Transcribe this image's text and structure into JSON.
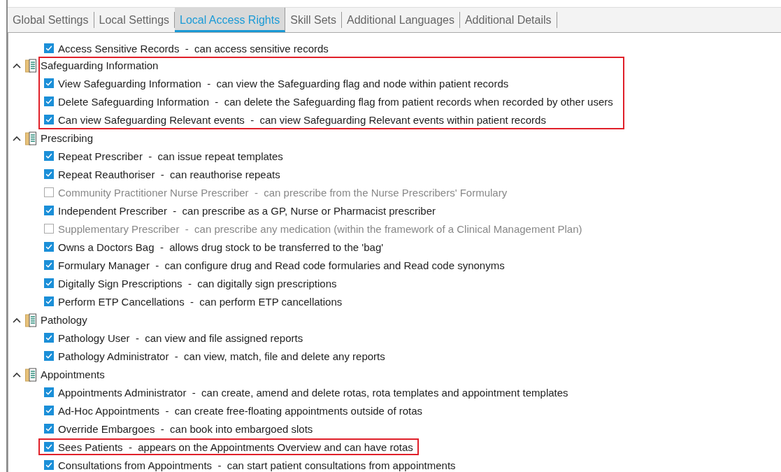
{
  "tabs": [
    {
      "label": "Global Settings",
      "selected": false
    },
    {
      "label": "Local Settings",
      "selected": false
    },
    {
      "label": "Local Access Rights",
      "selected": true
    },
    {
      "label": "Skill Sets",
      "selected": false
    },
    {
      "label": "Additional Languages",
      "selected": false
    },
    {
      "label": "Additional Details",
      "selected": false
    }
  ],
  "top_items": [
    {
      "text": "Access Sensitive Records  -  can access sensitive records",
      "checked": true,
      "disabled": false,
      "highlighted": false
    }
  ],
  "groups": [
    {
      "label": "Safeguarding Information",
      "expanded": true,
      "highlighted": true,
      "children": [
        {
          "text": "View Safeguarding Information  -  can view the Safeguarding flag and node within patient records",
          "checked": true,
          "disabled": false,
          "highlighted": false
        },
        {
          "text": "Delete Safeguarding Information  -  can delete the Safeguarding flag from patient records when recorded by other users",
          "checked": true,
          "disabled": false,
          "highlighted": false
        },
        {
          "text": "Can view Safeguarding Relevant events  -  can view Safeguarding Relevant events within patient records",
          "checked": true,
          "disabled": false,
          "highlighted": false
        }
      ]
    },
    {
      "label": "Prescribing",
      "expanded": true,
      "highlighted": false,
      "children": [
        {
          "text": "Repeat Prescriber  -  can issue repeat templates",
          "checked": true,
          "disabled": false,
          "highlighted": false
        },
        {
          "text": "Repeat Reauthoriser  -  can reauthorise repeats",
          "checked": true,
          "disabled": false,
          "highlighted": false
        },
        {
          "text": "Community Practitioner Nurse Prescriber  -  can prescribe from the Nurse Prescribers' Formulary",
          "checked": false,
          "disabled": true,
          "highlighted": false
        },
        {
          "text": "Independent Prescriber  -  can prescribe as a GP, Nurse or Pharmacist prescriber",
          "checked": true,
          "disabled": false,
          "highlighted": false
        },
        {
          "text": "Supplementary Prescriber  -  can prescribe any medication (within the framework of a Clinical Management Plan)",
          "checked": false,
          "disabled": true,
          "highlighted": false
        },
        {
          "text": "Owns a Doctors Bag  -  allows drug stock to be transferred to the 'bag'",
          "checked": true,
          "disabled": false,
          "highlighted": false
        },
        {
          "text": "Formulary Manager  -  can configure drug and Read code formularies and Read code synonyms",
          "checked": true,
          "disabled": false,
          "highlighted": false
        },
        {
          "text": "Digitally Sign Prescriptions  -  can digitally sign prescriptions",
          "checked": true,
          "disabled": false,
          "highlighted": false
        },
        {
          "text": "Perform ETP Cancellations  -  can perform ETP cancellations",
          "checked": true,
          "disabled": false,
          "highlighted": false
        }
      ]
    },
    {
      "label": "Pathology",
      "expanded": true,
      "highlighted": false,
      "children": [
        {
          "text": "Pathology User  -  can view and file assigned reports",
          "checked": true,
          "disabled": false,
          "highlighted": false
        },
        {
          "text": "Pathology Administrator  -  can view, match, file and delete any reports",
          "checked": true,
          "disabled": false,
          "highlighted": false
        }
      ]
    },
    {
      "label": "Appointments",
      "expanded": true,
      "highlighted": false,
      "children": [
        {
          "text": "Appointments Administrator  -  can create, amend and delete rotas, rota templates and appointment templates",
          "checked": true,
          "disabled": false,
          "highlighted": false
        },
        {
          "text": "Ad-Hoc Appointments  -  can create free-floating appointments outside of rotas",
          "checked": true,
          "disabled": false,
          "highlighted": false
        },
        {
          "text": "Override Embargoes  -  can book into embargoed slots",
          "checked": true,
          "disabled": false,
          "highlighted": false
        },
        {
          "text": "Sees Patients  -  appears on the Appointments Overview and can have rotas",
          "checked": true,
          "disabled": false,
          "highlighted": true
        },
        {
          "text": "Consultations from Appointments  -  can start patient consultations from appointments",
          "checked": true,
          "disabled": false,
          "highlighted": false
        }
      ]
    }
  ]
}
